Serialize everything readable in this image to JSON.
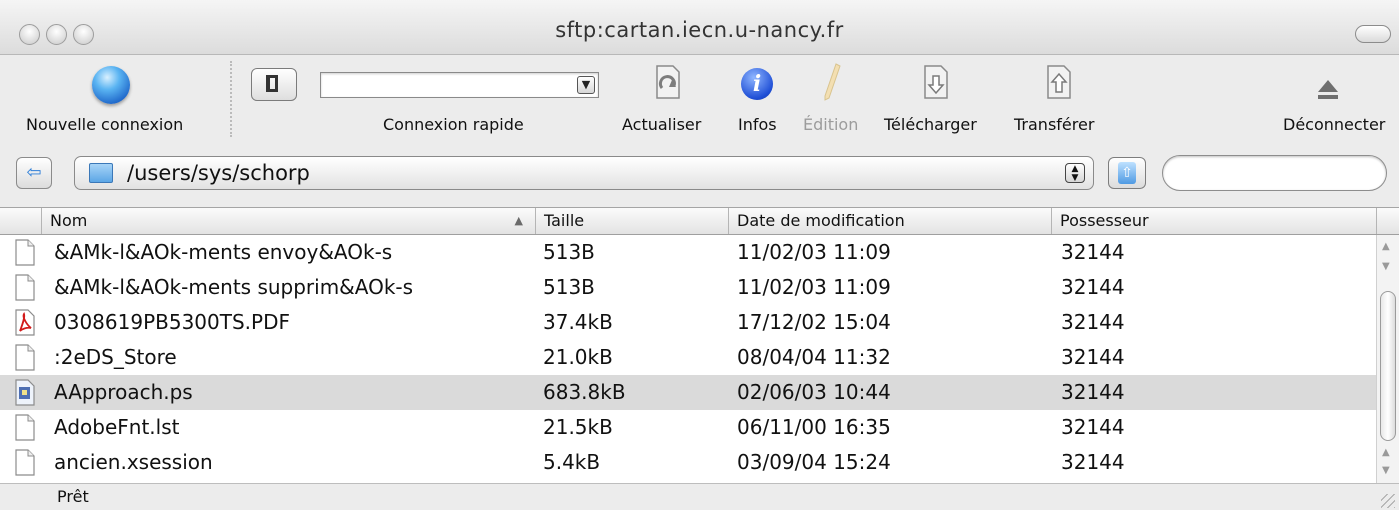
{
  "window": {
    "title": "sftp:cartan.iecn.u-nancy.fr"
  },
  "toolbar": {
    "new_connection_label": "Nouvelle connexion",
    "quick_connect_label": "Connexion rapide",
    "quick_connect_value": "",
    "refresh_label": "Actualiser",
    "info_label": "Infos",
    "edit_label": "Édition",
    "download_label": "Télécharger",
    "upload_label": "Transférer",
    "disconnect_label": "Déconnecter"
  },
  "pathbar": {
    "path": "/users/sys/schorp",
    "search_value": ""
  },
  "table": {
    "columns": [
      "Nom",
      "Taille",
      "Date de modification",
      "Possesseur"
    ],
    "sorted_column": "Nom",
    "rows": [
      {
        "name": "&AMk-l&AOk-ments envoy&AOk-s",
        "size": "513B",
        "date": "11/02/03 11:09",
        "owner": "32144",
        "icon": "generic-file-icon"
      },
      {
        "name": "&AMk-l&AOk-ments supprim&AOk-s",
        "size": "513B",
        "date": "11/02/03 11:09",
        "owner": "32144",
        "icon": "generic-file-icon"
      },
      {
        "name": "0308619PB5300TS.PDF",
        "size": "37.4kB",
        "date": "17/12/02 15:04",
        "owner": "32144",
        "icon": "pdf-file-icon"
      },
      {
        "name": ":2eDS_Store",
        "size": "21.0kB",
        "date": "08/04/04 11:32",
        "owner": "32144",
        "icon": "generic-file-icon"
      },
      {
        "name": "AApproach.ps",
        "size": "683.8kB",
        "date": "02/06/03 10:44",
        "owner": "32144",
        "icon": "postscript-file-icon",
        "selected": true
      },
      {
        "name": "AdobeFnt.lst",
        "size": "21.5kB",
        "date": "06/11/00 16:35",
        "owner": "32144",
        "icon": "generic-file-icon"
      },
      {
        "name": "ancien.xsession",
        "size": "5.4kB",
        "date": "03/09/04 15:24",
        "owner": "32144",
        "icon": "generic-file-icon"
      }
    ]
  },
  "status": {
    "text": "Prêt"
  }
}
